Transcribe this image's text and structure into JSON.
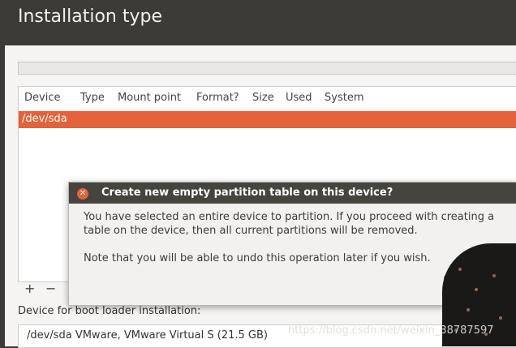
{
  "header": {
    "title": "Installation type"
  },
  "table": {
    "columns": [
      "Device",
      "Type",
      "Mount point",
      "Format?",
      "Size",
      "Used",
      "System"
    ],
    "rows": [
      {
        "device": "/dev/sda"
      }
    ]
  },
  "tools": {
    "add": "+",
    "remove": "−"
  },
  "boot": {
    "label": "Device for boot loader installation:",
    "value": "/dev/sda  VMware, VMware Virtual S (21.5 GB)"
  },
  "dialog": {
    "title": "Create new empty partition table on this device?",
    "line1": "You have selected an entire device to partition. If you proceed with creating a",
    "line2": "table on the device, then all current partitions will be removed.",
    "line3": "Note that you will be able to undo this operation later if you wish.",
    "close_glyph": "✕"
  },
  "watermark": "https://blog.csdn.net/weixin_38787597",
  "colors": {
    "accent": "#e4623a",
    "titlebar": "#3c3b37",
    "dialog_header": "#45443f"
  }
}
